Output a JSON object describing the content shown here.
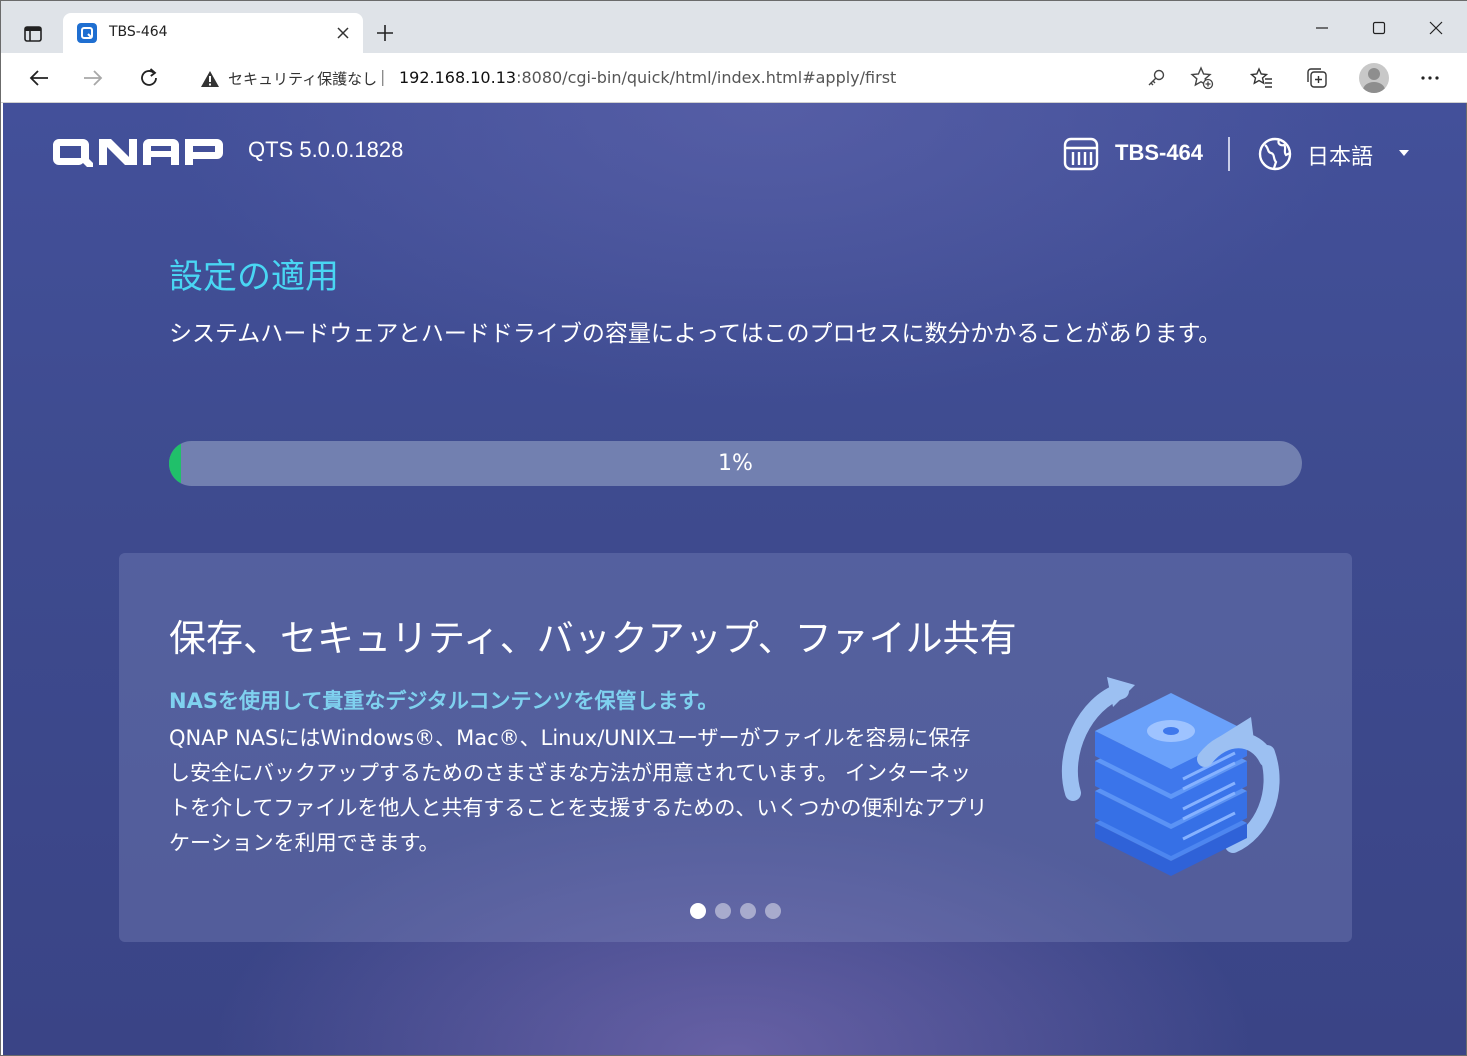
{
  "browser": {
    "tab_title": "TBS-464",
    "security_warning": "セキュリティ保護なし",
    "url_separator": "|",
    "url_host": "192.168.10.13",
    "url_rest": ":8080/cgi-bin/quick/html/index.html#apply/first"
  },
  "header": {
    "brand": "QNAP",
    "version": "QTS 5.0.0.1828",
    "device_name": "TBS-464",
    "language": "日本語"
  },
  "main": {
    "title": "設定の適用",
    "description": "システムハードウェアとハードドライブの容量によってはこのプロセスに数分かかることがあります。",
    "progress": {
      "value_percent": 1,
      "label": "1%"
    }
  },
  "card": {
    "title": "保存、セキュリティ、バックアップ、ファイル共有",
    "subtitle": "NASを使用して貴重なデジタルコンテンツを保管します。",
    "body": "QNAP NASにはWindows®、Mac®、Linux/UNIXユーザーがファイルを容易に保存し安全にバックアップするためのさまざまな方法が用意されています。 インターネットを介してファイルを他人と共有することを支援するための、いくつかの便利なアプリケーションを利用できます。",
    "carousel": {
      "total": 4,
      "active_index": 0
    }
  },
  "colors": {
    "accent_title": "#49d6f3",
    "subtitle": "#7fd1ef",
    "progress_fill": "#20c06a",
    "progress_track": "#7280b0"
  }
}
